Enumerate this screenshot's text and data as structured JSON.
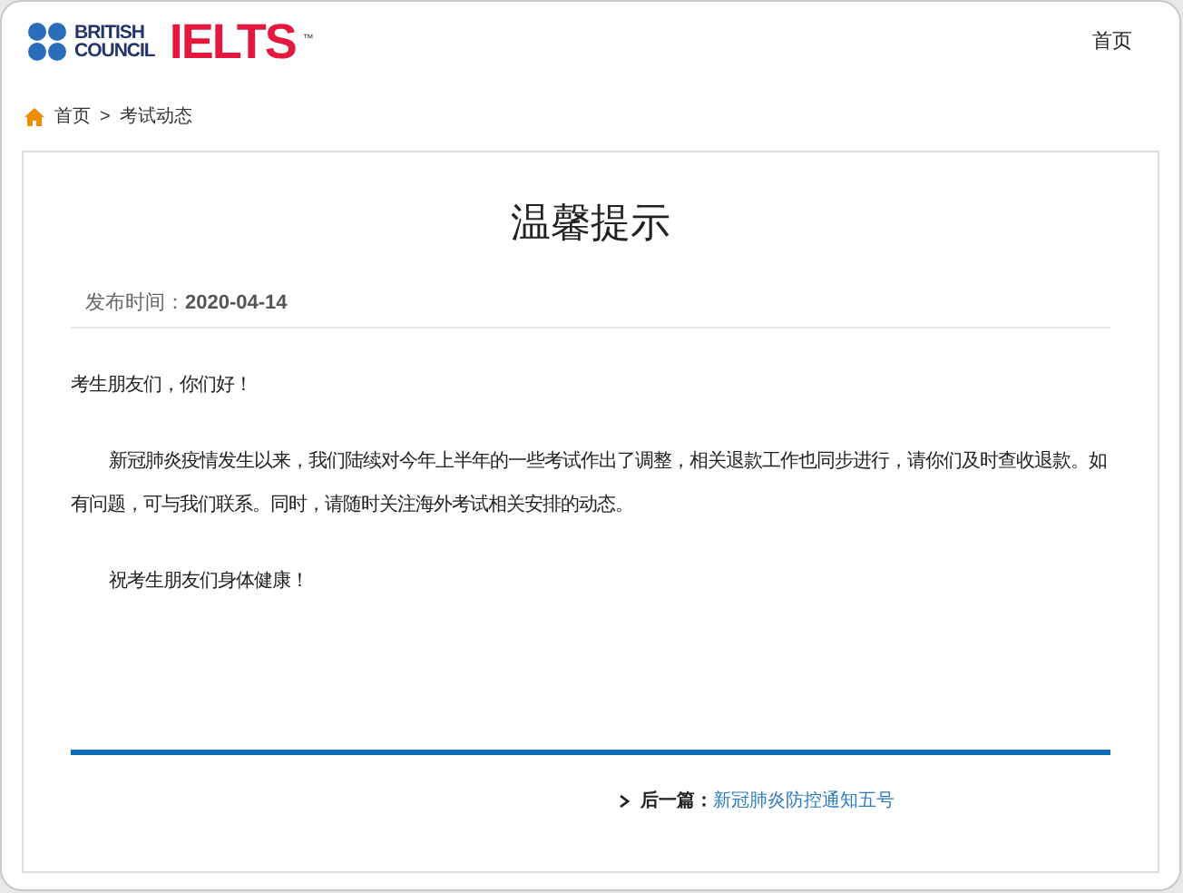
{
  "header": {
    "logo": {
      "line_1": "BRITISH",
      "line_2": "COUNCIL",
      "brand": "IELTS",
      "trademark": "™"
    },
    "nav": [
      "首页"
    ]
  },
  "breadcrumb": [
    "首页",
    "考试动态"
  ],
  "breadcrumb_separator": ">",
  "article": {
    "title": "温馨提示",
    "date_label": "发布时间：",
    "date": "2020-04-14",
    "paragraphs": [
      {
        "text": "考生朋友们，你们好！",
        "indent": false
      },
      {
        "text": "新冠肺炎疫情发生以来，我们陆续对今年上半年的一些考试作出了调整，相关退款工作也同步进行，请你们及时查收退款。如有问题，可与我们联系。同时，请随时关注海外考试相关安排的动态。",
        "indent": true
      },
      {
        "text": "祝考生朋友们身体健康！",
        "indent": true
      }
    ],
    "next": {
      "label": "后一篇：",
      "link": "新冠肺炎防控通知五号"
    }
  }
}
